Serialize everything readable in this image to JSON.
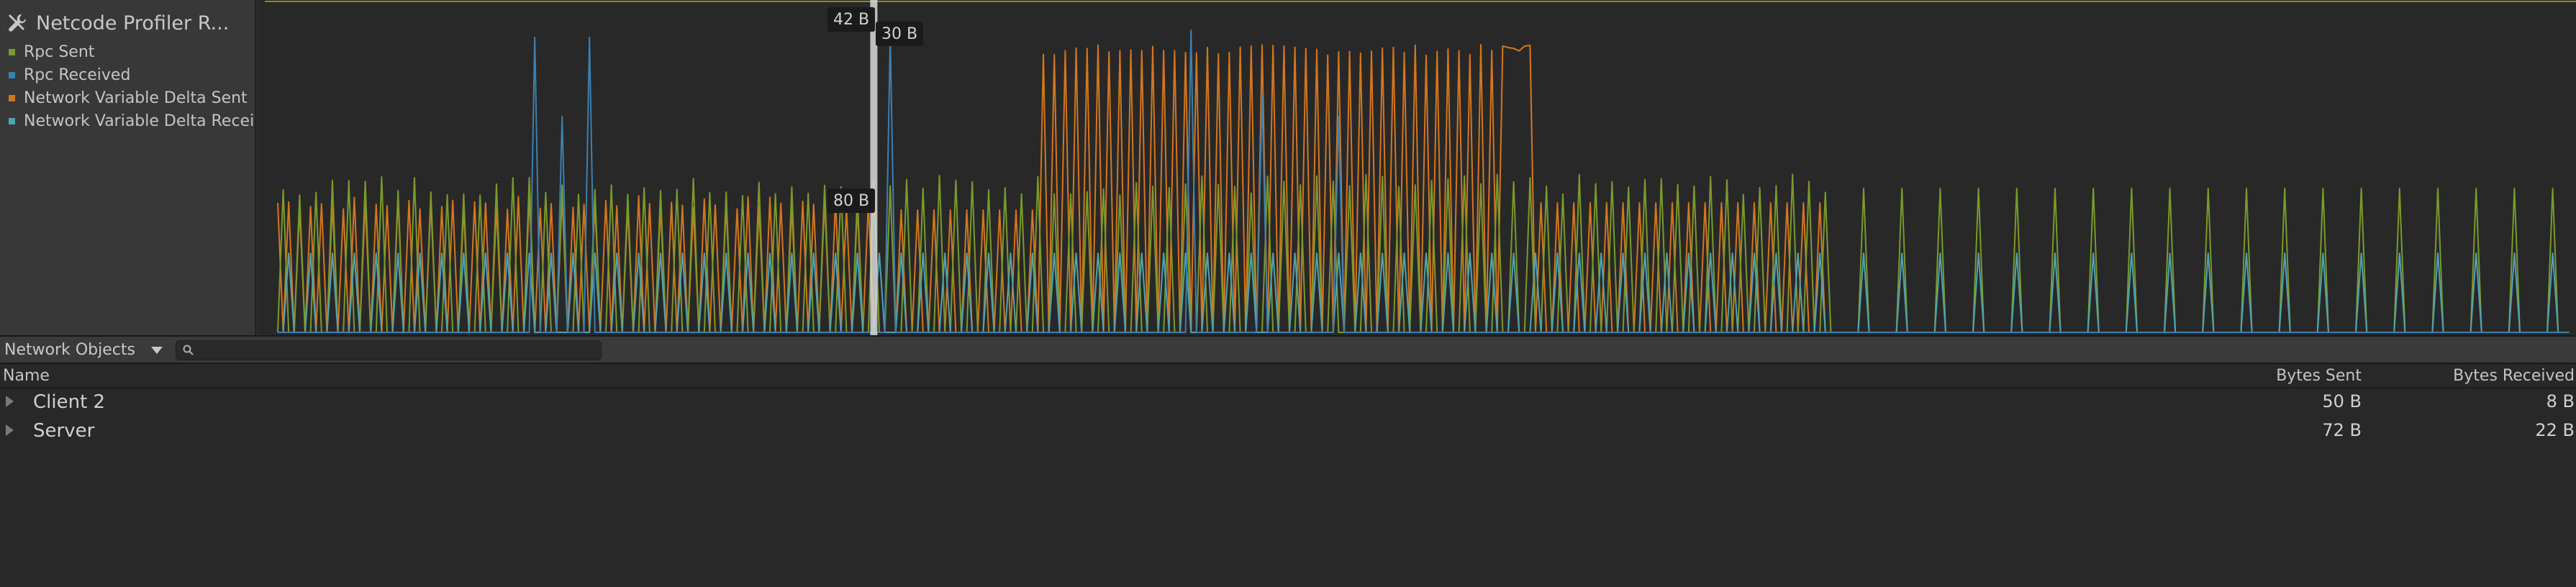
{
  "module": {
    "title": "Netcode Profiler R...",
    "icon": "tools-icon"
  },
  "legend": [
    {
      "label": "Rpc Sent",
      "color": "#7a9a2a"
    },
    {
      "label": "Rpc Received",
      "color": "#3d7fb0"
    },
    {
      "label": "Network Variable Delta Sent",
      "color": "#d4761e"
    },
    {
      "label": "Network Variable Delta Received",
      "color": "#4fa3b3"
    }
  ],
  "chart_data": {
    "type": "line",
    "tooltips": [
      "42 B",
      "30 B",
      "80 B"
    ],
    "selected_frame": 109,
    "frame_count": 420,
    "series": [
      {
        "name": "Rpc Sent",
        "color": "#7a9a2a"
      },
      {
        "name": "Rpc Received",
        "color": "#3d7fb0"
      },
      {
        "name": "Network Variable Delta Sent",
        "color": "#d4761e"
      },
      {
        "name": "Network Variable Delta Received",
        "color": "#4fa3b3"
      }
    ]
  },
  "toolbar": {
    "view_label": "Network Objects",
    "search_value": "",
    "search_placeholder": ""
  },
  "table": {
    "columns": {
      "name": "Name",
      "sent": "Bytes Sent",
      "received": "Bytes Received"
    },
    "rows": [
      {
        "name": "Client 2",
        "sent": "50 B",
        "received": "8 B"
      },
      {
        "name": "Server",
        "sent": "72 B",
        "received": "22 B"
      }
    ]
  }
}
